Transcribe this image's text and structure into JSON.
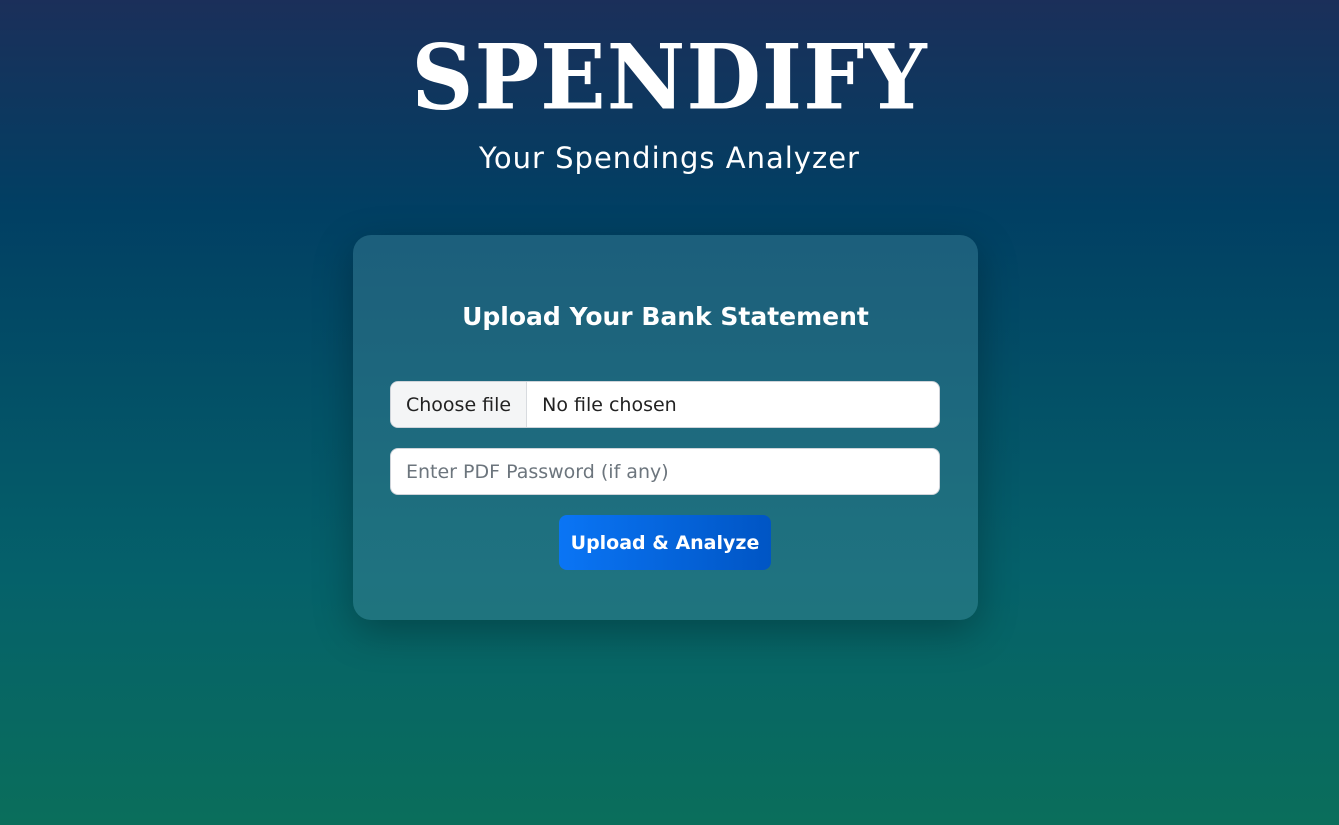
{
  "header": {
    "title": "SPENDIFY",
    "subtitle": "Your Spendings Analyzer"
  },
  "upload_card": {
    "heading": "Upload Your Bank Statement",
    "file_input": {
      "button_label": "Choose file",
      "status": "No file chosen"
    },
    "password_input": {
      "value": "",
      "placeholder": "Enter PDF Password (if any)"
    },
    "submit_label": "Upload & Analyze"
  },
  "colors": {
    "background_top": "#1b2f5a",
    "background_mid": "#013f63",
    "background_bottom": "#0a6e5b",
    "button_primary": "#0a75f5",
    "text": "#ffffff"
  }
}
